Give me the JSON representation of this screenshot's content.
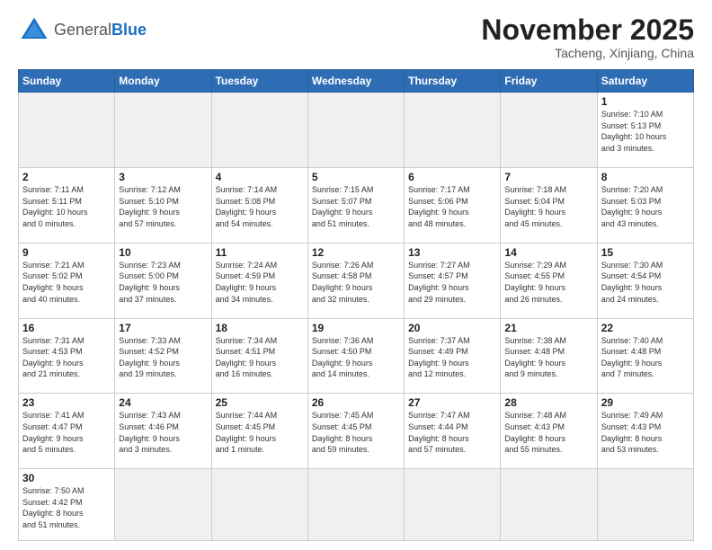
{
  "header": {
    "logo": {
      "general": "General",
      "blue": "Blue"
    },
    "title": "November 2025",
    "location": "Tacheng, Xinjiang, China"
  },
  "weekdays": [
    "Sunday",
    "Monday",
    "Tuesday",
    "Wednesday",
    "Thursday",
    "Friday",
    "Saturday"
  ],
  "weeks": [
    [
      {
        "day": "",
        "info": "",
        "empty": true
      },
      {
        "day": "",
        "info": "",
        "empty": true
      },
      {
        "day": "",
        "info": "",
        "empty": true
      },
      {
        "day": "",
        "info": "",
        "empty": true
      },
      {
        "day": "",
        "info": "",
        "empty": true
      },
      {
        "day": "",
        "info": "",
        "empty": true
      },
      {
        "day": "1",
        "info": "Sunrise: 7:10 AM\nSunset: 5:13 PM\nDaylight: 10 hours\nand 3 minutes."
      }
    ],
    [
      {
        "day": "2",
        "info": "Sunrise: 7:11 AM\nSunset: 5:11 PM\nDaylight: 10 hours\nand 0 minutes."
      },
      {
        "day": "3",
        "info": "Sunrise: 7:12 AM\nSunset: 5:10 PM\nDaylight: 9 hours\nand 57 minutes."
      },
      {
        "day": "4",
        "info": "Sunrise: 7:14 AM\nSunset: 5:08 PM\nDaylight: 9 hours\nand 54 minutes."
      },
      {
        "day": "5",
        "info": "Sunrise: 7:15 AM\nSunset: 5:07 PM\nDaylight: 9 hours\nand 51 minutes."
      },
      {
        "day": "6",
        "info": "Sunrise: 7:17 AM\nSunset: 5:06 PM\nDaylight: 9 hours\nand 48 minutes."
      },
      {
        "day": "7",
        "info": "Sunrise: 7:18 AM\nSunset: 5:04 PM\nDaylight: 9 hours\nand 45 minutes."
      },
      {
        "day": "8",
        "info": "Sunrise: 7:20 AM\nSunset: 5:03 PM\nDaylight: 9 hours\nand 43 minutes."
      }
    ],
    [
      {
        "day": "9",
        "info": "Sunrise: 7:21 AM\nSunset: 5:02 PM\nDaylight: 9 hours\nand 40 minutes."
      },
      {
        "day": "10",
        "info": "Sunrise: 7:23 AM\nSunset: 5:00 PM\nDaylight: 9 hours\nand 37 minutes."
      },
      {
        "day": "11",
        "info": "Sunrise: 7:24 AM\nSunset: 4:59 PM\nDaylight: 9 hours\nand 34 minutes."
      },
      {
        "day": "12",
        "info": "Sunrise: 7:26 AM\nSunset: 4:58 PM\nDaylight: 9 hours\nand 32 minutes."
      },
      {
        "day": "13",
        "info": "Sunrise: 7:27 AM\nSunset: 4:57 PM\nDaylight: 9 hours\nand 29 minutes."
      },
      {
        "day": "14",
        "info": "Sunrise: 7:29 AM\nSunset: 4:55 PM\nDaylight: 9 hours\nand 26 minutes."
      },
      {
        "day": "15",
        "info": "Sunrise: 7:30 AM\nSunset: 4:54 PM\nDaylight: 9 hours\nand 24 minutes."
      }
    ],
    [
      {
        "day": "16",
        "info": "Sunrise: 7:31 AM\nSunset: 4:53 PM\nDaylight: 9 hours\nand 21 minutes."
      },
      {
        "day": "17",
        "info": "Sunrise: 7:33 AM\nSunset: 4:52 PM\nDaylight: 9 hours\nand 19 minutes."
      },
      {
        "day": "18",
        "info": "Sunrise: 7:34 AM\nSunset: 4:51 PM\nDaylight: 9 hours\nand 16 minutes."
      },
      {
        "day": "19",
        "info": "Sunrise: 7:36 AM\nSunset: 4:50 PM\nDaylight: 9 hours\nand 14 minutes."
      },
      {
        "day": "20",
        "info": "Sunrise: 7:37 AM\nSunset: 4:49 PM\nDaylight: 9 hours\nand 12 minutes."
      },
      {
        "day": "21",
        "info": "Sunrise: 7:38 AM\nSunset: 4:48 PM\nDaylight: 9 hours\nand 9 minutes."
      },
      {
        "day": "22",
        "info": "Sunrise: 7:40 AM\nSunset: 4:48 PM\nDaylight: 9 hours\nand 7 minutes."
      }
    ],
    [
      {
        "day": "23",
        "info": "Sunrise: 7:41 AM\nSunset: 4:47 PM\nDaylight: 9 hours\nand 5 minutes."
      },
      {
        "day": "24",
        "info": "Sunrise: 7:43 AM\nSunset: 4:46 PM\nDaylight: 9 hours\nand 3 minutes."
      },
      {
        "day": "25",
        "info": "Sunrise: 7:44 AM\nSunset: 4:45 PM\nDaylight: 9 hours\nand 1 minute."
      },
      {
        "day": "26",
        "info": "Sunrise: 7:45 AM\nSunset: 4:45 PM\nDaylight: 8 hours\nand 59 minutes."
      },
      {
        "day": "27",
        "info": "Sunrise: 7:47 AM\nSunset: 4:44 PM\nDaylight: 8 hours\nand 57 minutes."
      },
      {
        "day": "28",
        "info": "Sunrise: 7:48 AM\nSunset: 4:43 PM\nDaylight: 8 hours\nand 55 minutes."
      },
      {
        "day": "29",
        "info": "Sunrise: 7:49 AM\nSunset: 4:43 PM\nDaylight: 8 hours\nand 53 minutes."
      }
    ],
    [
      {
        "day": "30",
        "info": "Sunrise: 7:50 AM\nSunset: 4:42 PM\nDaylight: 8 hours\nand 51 minutes.",
        "lastrow": true
      },
      {
        "day": "",
        "info": "",
        "empty": true,
        "lastrow": true
      },
      {
        "day": "",
        "info": "",
        "empty": true,
        "lastrow": true
      },
      {
        "day": "",
        "info": "",
        "empty": true,
        "lastrow": true
      },
      {
        "day": "",
        "info": "",
        "empty": true,
        "lastrow": true
      },
      {
        "day": "",
        "info": "",
        "empty": true,
        "lastrow": true
      },
      {
        "day": "",
        "info": "",
        "empty": true,
        "lastrow": true
      }
    ]
  ]
}
